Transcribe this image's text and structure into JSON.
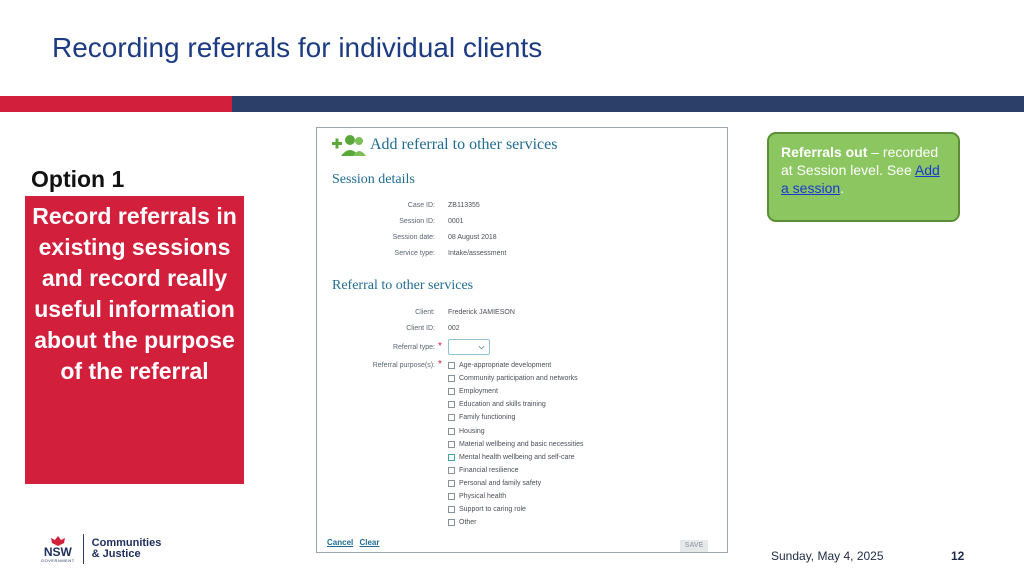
{
  "slide": {
    "title": "Recording referrals for individual clients",
    "option_label": "Option 1",
    "red_box_text": "Record referrals in existing sessions and record really useful information about the purpose of the referral"
  },
  "callout": {
    "bold_text": "Referrals out",
    "text": " – recorded at Session level. See ",
    "link_text": "Add a session",
    "tail": "."
  },
  "form": {
    "title": "Add referral to other services",
    "section_session": "Session details",
    "session_fields": [
      {
        "label": "Case ID:",
        "value": "ZB113355"
      },
      {
        "label": "Session ID:",
        "value": "0001"
      },
      {
        "label": "Session date:",
        "value": "08 August 2018"
      },
      {
        "label": "Service type:",
        "value": "Intake/assessment"
      }
    ],
    "section_referral": "Referral to other services",
    "client_fields": [
      {
        "label": "Client:",
        "value": "Frederick JAMIESON"
      },
      {
        "label": "Client ID:",
        "value": "002"
      }
    ],
    "referral_type_label": "Referral type:",
    "referral_purpose_label": "Referral purpose(s):",
    "required_marker": "*",
    "purposes": [
      "Age-appropriate development",
      "Community participation and networks",
      "Employment",
      "Education and skills training",
      "Family functioning",
      "Housing",
      "Material wellbeing and basic necessities",
      "Mental health wellbeing and self-care",
      "Financial resilience",
      "Personal and family safety",
      "Physical health",
      "Support to caring role",
      "Other"
    ],
    "cancel_label": "Cancel",
    "clear_label": "Clear",
    "save_label": "SAVE"
  },
  "logo": {
    "nsw": "NSW",
    "gov": "GOVERNMENT",
    "dept_line1": "Communities",
    "dept_line2": "& Justice"
  },
  "footer": {
    "date": "Sunday, May 4, 2025",
    "page": "12"
  },
  "colors": {
    "accent_red": "#d21f3c",
    "accent_blue": "#2b3f69",
    "callout_green": "#8cc660",
    "title_blue": "#1c3b82"
  }
}
